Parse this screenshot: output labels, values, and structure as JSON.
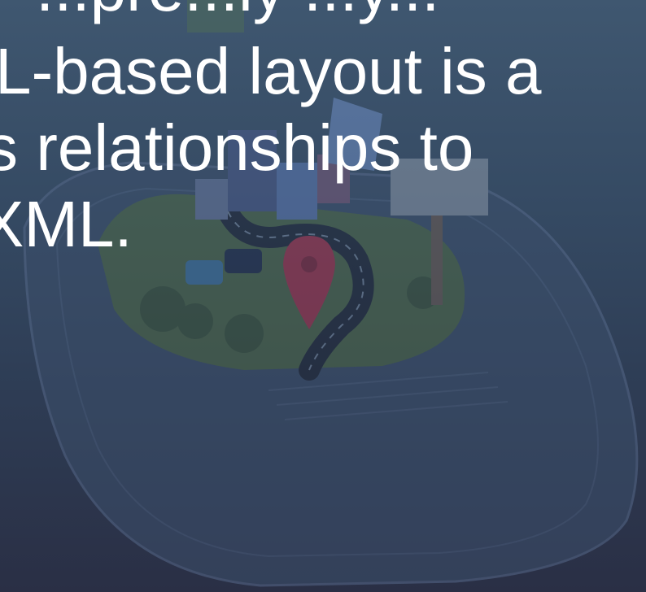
{
  "slide": {
    "text_lines": [
      "...pre...ly ...y...",
      "L-based layout is a",
      "s relationships to",
      "XML."
    ]
  },
  "illustration": {
    "icon": "map-pin-icon",
    "accent_color": "#b0304a",
    "road_color": "#1e2433",
    "ground_color": "#4f6a45"
  }
}
